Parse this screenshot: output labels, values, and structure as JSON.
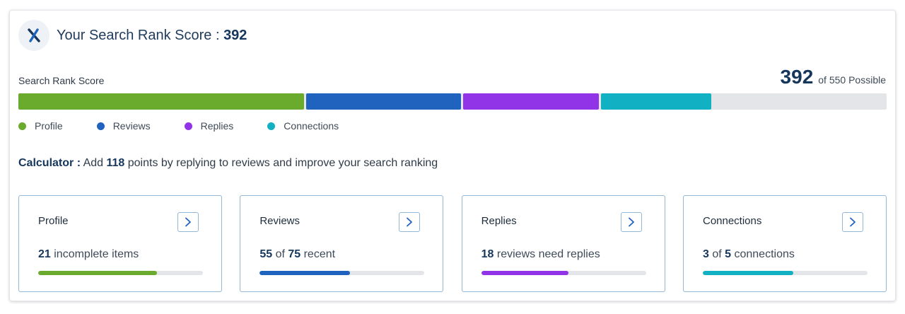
{
  "header": {
    "title": "Your Search Rank Score : ",
    "score": "392"
  },
  "score_bar": {
    "label": "Search Rank Score",
    "value": "392",
    "of_text": "of 550 Possible",
    "total": 550,
    "segments": [
      {
        "name": "Profile",
        "points": 181,
        "color": "#6aab2e"
      },
      {
        "name": "Reviews",
        "points": 98,
        "color": "#1f63bf"
      },
      {
        "name": "Replies",
        "points": 86,
        "color": "#9134e8"
      },
      {
        "name": "Connections",
        "points": 70,
        "color": "#11b1c3"
      }
    ]
  },
  "legend": [
    {
      "label": "Profile",
      "color": "#6aab2e"
    },
    {
      "label": "Reviews",
      "color": "#1f63bf"
    },
    {
      "label": "Replies",
      "color": "#9134e8"
    },
    {
      "label": "Connections",
      "color": "#11b1c3"
    }
  ],
  "calculator": {
    "label": "Calculator :",
    "pre": " Add ",
    "points": "118",
    "post": " points by replying to reviews and improve your search ranking"
  },
  "cards": [
    {
      "title": "Profile",
      "strong": "21",
      "mid": " incomplete items",
      "strong2": "",
      "tail": "",
      "progress": 0.72,
      "color": "#6aab2e"
    },
    {
      "title": "Reviews",
      "strong": "55",
      "mid": " of ",
      "strong2": "75",
      "tail": " recent",
      "progress": 0.55,
      "color": "#1f63bf"
    },
    {
      "title": "Replies",
      "strong": "18",
      "mid": " reviews need replies",
      "strong2": "",
      "tail": "",
      "progress": 0.53,
      "color": "#9134e8"
    },
    {
      "title": "Connections",
      "strong": "3",
      "mid": " of ",
      "strong2": "5",
      "tail": " connections",
      "progress": 0.55,
      "color": "#11b1c3"
    }
  ]
}
